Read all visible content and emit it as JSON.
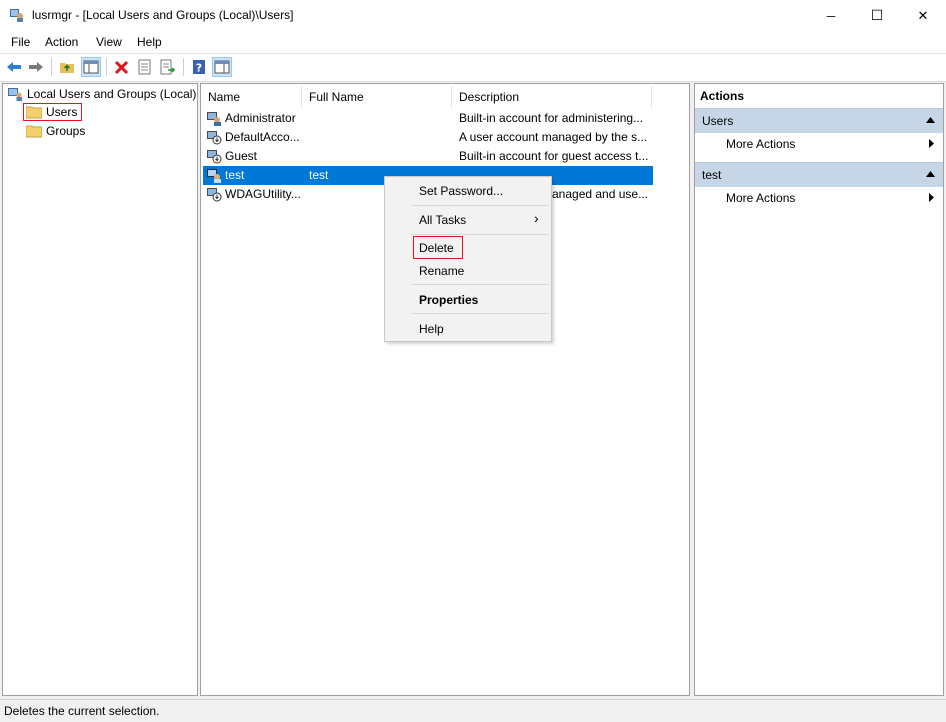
{
  "window": {
    "title": "lusrmgr - [Local Users and Groups (Local)\\Users]",
    "controls": {
      "minimize": "─",
      "maximize": "☐",
      "close": "✕"
    }
  },
  "menu": [
    "File",
    "Action",
    "View",
    "Help"
  ],
  "toolbar": {
    "buttons": [
      "back-icon",
      "forward-icon",
      "up-folder-icon",
      "show-hide-tree-icon",
      "delete-icon",
      "properties-icon",
      "export-list-icon",
      "help-icon",
      "action-pane-icon"
    ]
  },
  "tree": {
    "root": "Local Users and Groups (Local)",
    "children": [
      "Users",
      "Groups"
    ],
    "selected": "Users"
  },
  "list": {
    "columns": [
      "Name",
      "Full Name",
      "Description"
    ],
    "rows": [
      {
        "name": "Administrator",
        "full_name": "",
        "description": "Built-in account for administering..."
      },
      {
        "name": "DefaultAcco...",
        "full_name": "",
        "description": "A user account managed by the s..."
      },
      {
        "name": "Guest",
        "full_name": "",
        "description": "Built-in account for guest access t..."
      },
      {
        "name": "test",
        "full_name": "test",
        "description": ""
      },
      {
        "name": "WDAGUtility...",
        "full_name": "",
        "description": "anaged and use..."
      }
    ],
    "selected_index": 3
  },
  "context_menu": {
    "items": [
      "Set Password...",
      "All Tasks",
      "Delete",
      "Rename",
      "Properties",
      "Help"
    ],
    "submenu_arrow": "›",
    "highlighted": "Delete"
  },
  "actions": {
    "title": "Actions",
    "sections": [
      {
        "header": "Users",
        "items": [
          "More Actions"
        ]
      },
      {
        "header": "test",
        "items": [
          "More Actions"
        ]
      }
    ]
  },
  "status_bar": "Deletes the current selection.",
  "colors": {
    "selection": "#0078d7",
    "highlight_box": "#e81123",
    "action_header": "#c7d6e6"
  }
}
